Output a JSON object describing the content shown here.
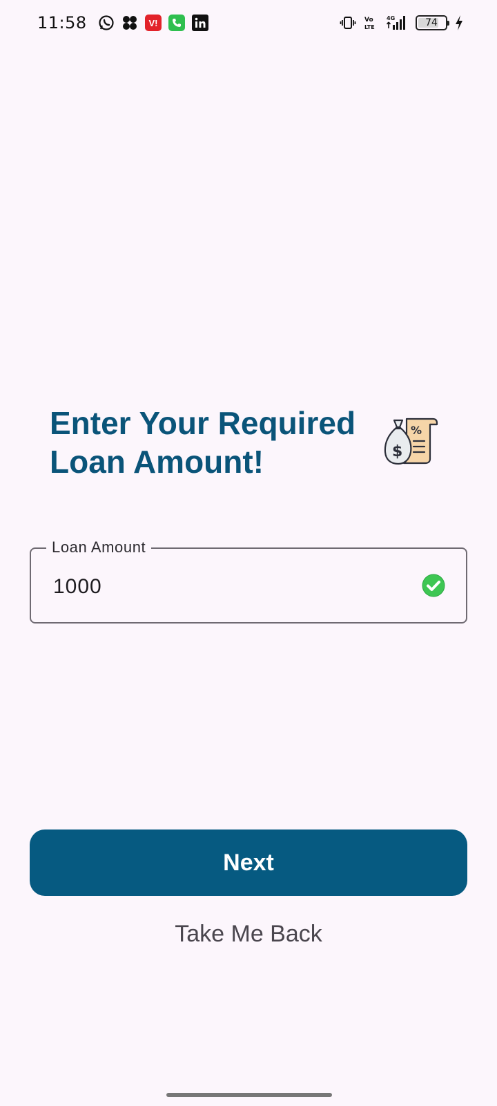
{
  "status_bar": {
    "time": "11:58",
    "apps": [
      "whatsapp-icon",
      "pinwheel-icon",
      "vi-icon",
      "phone-icon",
      "linkedin-icon"
    ],
    "signal_labels": {
      "volte": "Vo LTE",
      "network": "4G"
    },
    "battery": "74"
  },
  "main": {
    "heading": "Enter Your Required Loan Amount!",
    "field": {
      "label": "Loan Amount",
      "value": "1000"
    },
    "next_label": "Next",
    "back_label": "Take Me Back"
  },
  "colors": {
    "background": "#fcf6fc",
    "primary": "#065a81",
    "heading": "#0a5479",
    "valid": "#3ec653"
  }
}
